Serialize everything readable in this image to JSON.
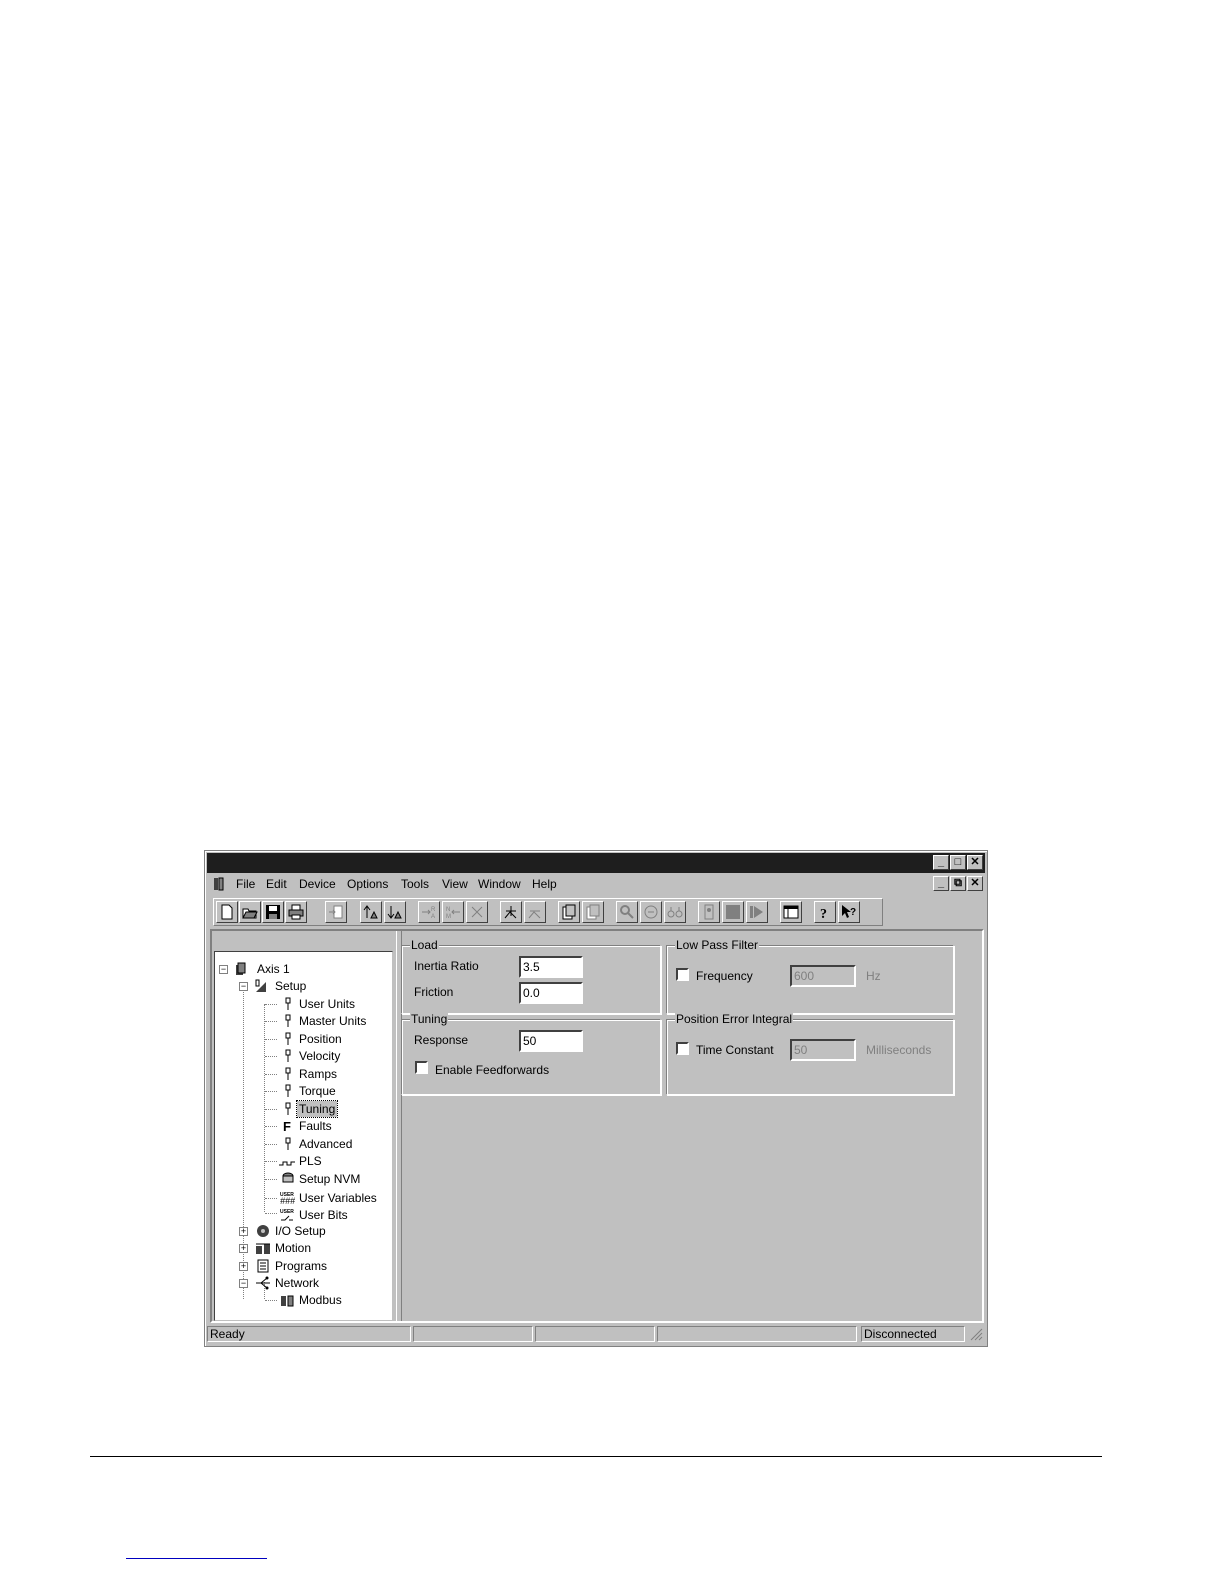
{
  "menubar": {
    "items": [
      "File",
      "Edit",
      "Device",
      "Options",
      "Tools",
      "View",
      "Window",
      "Help"
    ]
  },
  "window_buttons": {
    "minimize": "_",
    "maximize": "□",
    "restore": "⧉",
    "close": "✕"
  },
  "tree": {
    "root": "Axis 1",
    "setup": "Setup",
    "setup_children": [
      "User Units",
      "Master Units",
      "Position",
      "Velocity",
      "Ramps",
      "Torque",
      "Tuning",
      "Faults",
      "Advanced",
      "PLS",
      "Setup NVM",
      "User Variables",
      "User Bits"
    ],
    "selected": "Tuning",
    "top_nodes": [
      "I/O Setup",
      "Motion",
      "Programs",
      "Network"
    ],
    "network_children": [
      "Modbus"
    ]
  },
  "load": {
    "title": "Load",
    "inertia_label": "Inertia Ratio",
    "inertia_value": "3.5",
    "friction_label": "Friction",
    "friction_value": "0.0"
  },
  "tuning": {
    "title": "Tuning",
    "response_label": "Response",
    "response_value": "50",
    "feedforwards_label": "Enable Feedforwards",
    "feedforwards_checked": false
  },
  "low_pass": {
    "title": "Low Pass Filter",
    "frequency_label": "Frequency",
    "frequency_value": "600",
    "unit": "Hz",
    "checked": false
  },
  "pei": {
    "title": "Position Error Integral",
    "time_constant_label": "Time Constant",
    "time_constant_value": "50",
    "unit": "Milliseconds",
    "checked": false
  },
  "statusbar": {
    "left": "Ready",
    "right": "Disconnected"
  }
}
